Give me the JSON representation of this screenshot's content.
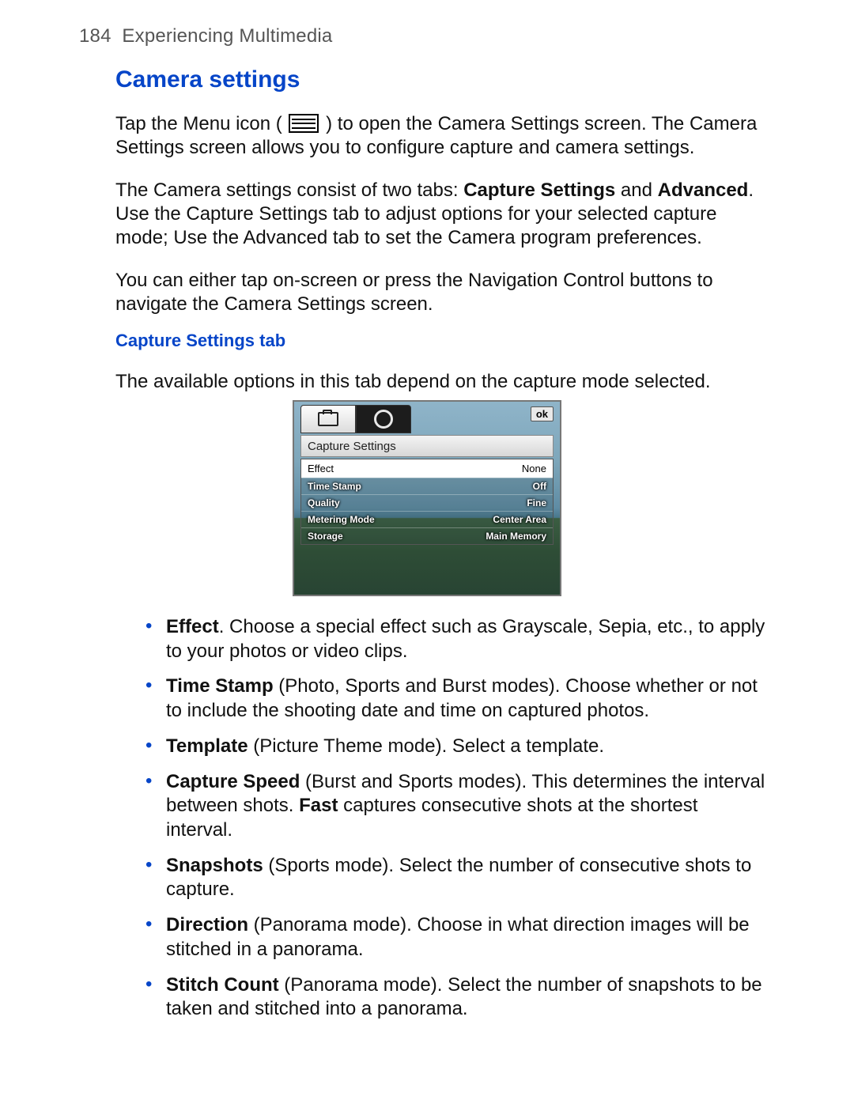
{
  "page": {
    "number": "184",
    "chapter": "Experiencing Multimedia"
  },
  "section": {
    "title": "Camera settings",
    "para1_a": "Tap the Menu icon (",
    "para1_b": ") to open the Camera Settings screen. The Camera Settings screen allows you to configure capture and camera settings.",
    "para2_a": "The Camera settings consist of two tabs: ",
    "para2_b1": "Capture Settings",
    "para2_c": " and ",
    "para2_b2": "Advanced",
    "para2_d": ". Use the Capture Settings tab to adjust options for your selected capture mode; Use the Advanced tab to set the Camera program preferences.",
    "para3": "You can either tap on-screen or press the Navigation Control buttons to navigate the Camera Settings screen."
  },
  "subsection": {
    "title": "Capture Settings tab",
    "intro": "The available options in this tab depend on the capture mode selected."
  },
  "screenshot": {
    "ok": "ok",
    "panel_title": "Capture Settings",
    "rows": [
      {
        "label": "Effect",
        "value": "None"
      },
      {
        "label": "Time Stamp",
        "value": "Off"
      },
      {
        "label": "Quality",
        "value": "Fine"
      },
      {
        "label": "Metering Mode",
        "value": "Center Area"
      },
      {
        "label": "Storage",
        "value": "Main Memory"
      }
    ]
  },
  "bullets": [
    {
      "term": "Effect",
      "rest": ". Choose a special effect such as Grayscale, Sepia, etc., to apply to your photos or video clips."
    },
    {
      "term": "Time Stamp",
      "rest": " (Photo, Sports and Burst modes). Choose whether or not to include the shooting date and time on captured photos."
    },
    {
      "term": "Template",
      "rest": " (Picture Theme mode). Select a template."
    },
    {
      "term": "Capture Speed",
      "rest_a": " (Burst and Sports modes). This determines the interval between shots. ",
      "bold2": "Fast",
      "rest_b": " captures consecutive shots at the shortest interval."
    },
    {
      "term": "Snapshots",
      "rest": " (Sports mode). Select the number of consecutive shots to capture."
    },
    {
      "term": "Direction",
      "rest": " (Panorama mode). Choose in what direction images will be stitched in a panorama."
    },
    {
      "term": "Stitch Count",
      "rest": " (Panorama mode). Select the number of snapshots to be taken and stitched into a panorama."
    }
  ]
}
